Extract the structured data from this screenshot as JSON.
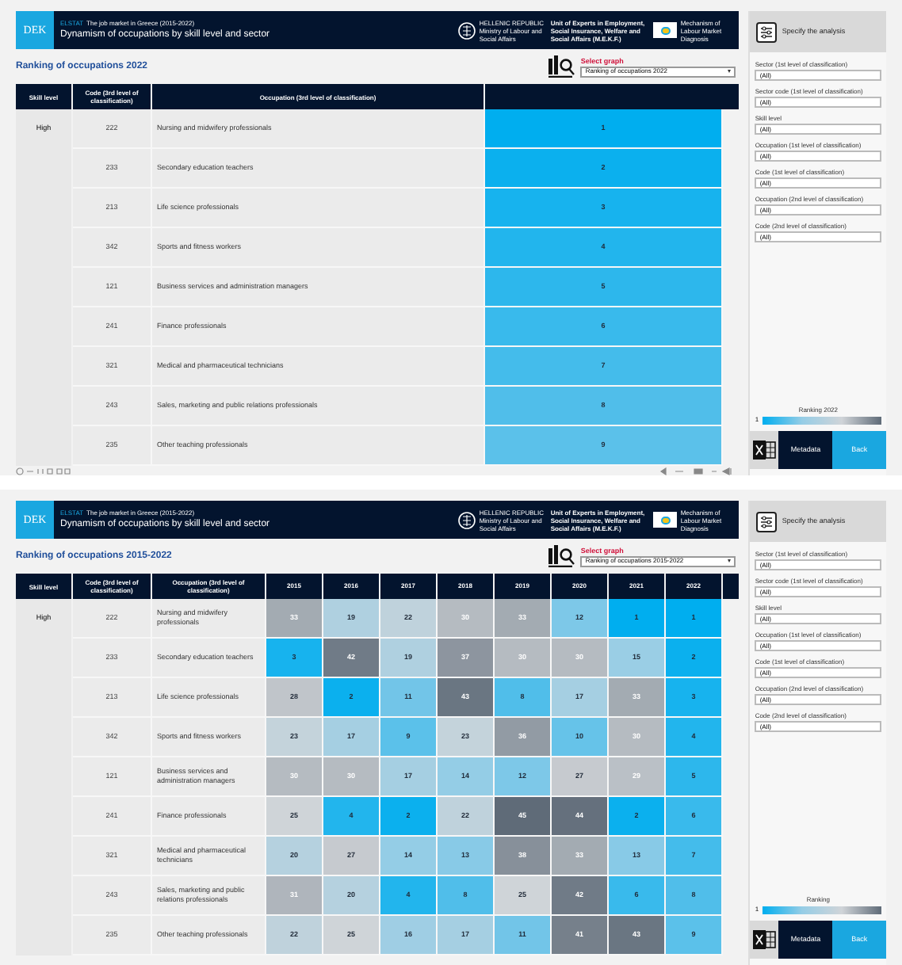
{
  "dashboards": [
    {
      "footer": true,
      "header": {
        "logo": "DEK",
        "source": "ELSTAT",
        "subtitle": "The job market in Greece (2015-2022)",
        "title": "Dynamism of occupations by skill level and sector",
        "ministry": [
          "HELLENIC REPUBLIC",
          "Ministry of Labour and Social Affairs"
        ],
        "unit": "Unit of Experts in Employment, Social Insurance, Welfare and Social Affairs (M.E.K.F.)",
        "mechanism": "Mechanism of Labour Market Diagnosis"
      },
      "ranking_title": "Ranking of occupations 2022",
      "select_graph": {
        "label": "Select graph",
        "value": "Ranking of occupations 2022"
      },
      "table": {
        "columns": [
          "Skill level",
          "Code (3rd level of classification)",
          "Occupation (3rd level of classification)"
        ],
        "groups": [
          {
            "skill_level": "High",
            "rows": [
              {
                "code": "222",
                "occupation": "Nursing and midwifery professionals",
                "values": [
                  "1"
                ]
              },
              {
                "code": "233",
                "occupation": "Secondary education teachers",
                "values": [
                  "2"
                ]
              },
              {
                "code": "213",
                "occupation": "Life science professionals",
                "values": [
                  "3"
                ]
              },
              {
                "code": "342",
                "occupation": "Sports and fitness workers",
                "values": [
                  "4"
                ]
              },
              {
                "code": "121",
                "occupation": "Business services and administration managers",
                "values": [
                  "5"
                ]
              },
              {
                "code": "241",
                "occupation": "Finance professionals",
                "values": [
                  "6"
                ]
              },
              {
                "code": "321",
                "occupation": "Medical and pharmaceutical technicians",
                "values": [
                  "7"
                ]
              },
              {
                "code": "243",
                "occupation": "Sales, marketing and public relations professionals",
                "values": [
                  "8"
                ]
              },
              {
                "code": "235",
                "occupation": "Other teaching professionals",
                "values": [
                  "9"
                ]
              }
            ]
          }
        ]
      },
      "sidebar": {
        "title": "Specify the analysis",
        "filters": [
          {
            "label": "Sector (1st level of classification)",
            "value": "(All)"
          },
          {
            "label": "Sector code (1st level of classification)",
            "value": "(All)"
          },
          {
            "label": "Skill level",
            "value": "(All)"
          },
          {
            "label": "Occupation (1st level of classification)",
            "value": "(All)"
          },
          {
            "label": "Code (1st level of classification)",
            "value": "(All)"
          },
          {
            "label": "Occupation (2nd level of classification)",
            "value": "(All)"
          },
          {
            "label": "Code (2nd level of classification)",
            "value": "(All)"
          }
        ],
        "legend": {
          "title": "Ranking 2022",
          "min": "1"
        },
        "buttons": [
          "Metadata",
          "Back"
        ]
      }
    },
    {
      "footer": false,
      "header": {
        "logo": "DEK",
        "source": "ELSTAT",
        "subtitle": "The job market in Greece (2015-2022)",
        "title": "Dynamism of occupations by skill level and sector",
        "ministry": [
          "HELLENIC REPUBLIC",
          "Ministry of Labour and Social Affairs"
        ],
        "unit": "Unit of Experts in Employment, Social Insurance, Welfare and Social Affairs (M.E.K.F.)",
        "mechanism": "Mechanism of Labour Market Diagnosis"
      },
      "ranking_title": "Ranking of occupations 2015-2022",
      "select_graph": {
        "label": "Select graph",
        "value": "Ranking of occupations 2015-2022"
      },
      "table": {
        "columns": [
          "Skill level",
          "Code (3rd level of classification)",
          "Occupation (3rd level of classification)"
        ],
        "years": [
          "2015",
          "2016",
          "2017",
          "2018",
          "2019",
          "2020",
          "2021",
          "2022"
        ],
        "groups": [
          {
            "skill_level": "High",
            "rows": [
              {
                "code": "222",
                "occupation": "Nursing and midwifery professionals",
                "values": [
                  "33",
                  "19",
                  "22",
                  "30",
                  "33",
                  "12",
                  "1",
                  "1"
                ]
              },
              {
                "code": "233",
                "occupation": "Secondary education teachers",
                "values": [
                  "3",
                  "42",
                  "19",
                  "37",
                  "30",
                  "30",
                  "15",
                  "2"
                ]
              },
              {
                "code": "213",
                "occupation": "Life science professionals",
                "values": [
                  "28",
                  "2",
                  "11",
                  "43",
                  "8",
                  "17",
                  "33",
                  "3"
                ]
              },
              {
                "code": "342",
                "occupation": "Sports and fitness workers",
                "values": [
                  "23",
                  "17",
                  "9",
                  "23",
                  "36",
                  "10",
                  "30",
                  "4"
                ]
              },
              {
                "code": "121",
                "occupation": "Business services and administration managers",
                "values": [
                  "30",
                  "30",
                  "17",
                  "14",
                  "12",
                  "27",
                  "29",
                  "5"
                ]
              },
              {
                "code": "241",
                "occupation": "Finance professionals",
                "values": [
                  "25",
                  "4",
                  "2",
                  "22",
                  "45",
                  "44",
                  "2",
                  "6"
                ]
              },
              {
                "code": "321",
                "occupation": "Medical and pharmaceutical technicians",
                "values": [
                  "20",
                  "27",
                  "14",
                  "13",
                  "38",
                  "33",
                  "13",
                  "7"
                ]
              },
              {
                "code": "243",
                "occupation": "Sales, marketing and public relations professionals",
                "values": [
                  "31",
                  "20",
                  "4",
                  "8",
                  "25",
                  "42",
                  "6",
                  "8"
                ]
              },
              {
                "code": "235",
                "occupation": "Other teaching professionals",
                "values": [
                  "22",
                  "25",
                  "16",
                  "17",
                  "11",
                  "41",
                  "43",
                  "9"
                ]
              }
            ]
          }
        ]
      },
      "sidebar": {
        "title": "Specify the analysis",
        "filters": [
          {
            "label": "Sector (1st level of classification)",
            "value": "(All)"
          },
          {
            "label": "Sector code (1st level of classification)",
            "value": "(All)"
          },
          {
            "label": "Skill level",
            "value": "(All)"
          },
          {
            "label": "Occupation (1st level of classification)",
            "value": "(All)"
          },
          {
            "label": "Code (1st level of classification)",
            "value": "(All)"
          },
          {
            "label": "Occupation (2nd level of classification)",
            "value": "(All)"
          },
          {
            "label": "Code (2nd level of classification)",
            "value": "(All)"
          }
        ],
        "legend": {
          "title": "Ranking",
          "min": "1"
        },
        "buttons": [
          "Metadata",
          "Back"
        ]
      }
    }
  ]
}
